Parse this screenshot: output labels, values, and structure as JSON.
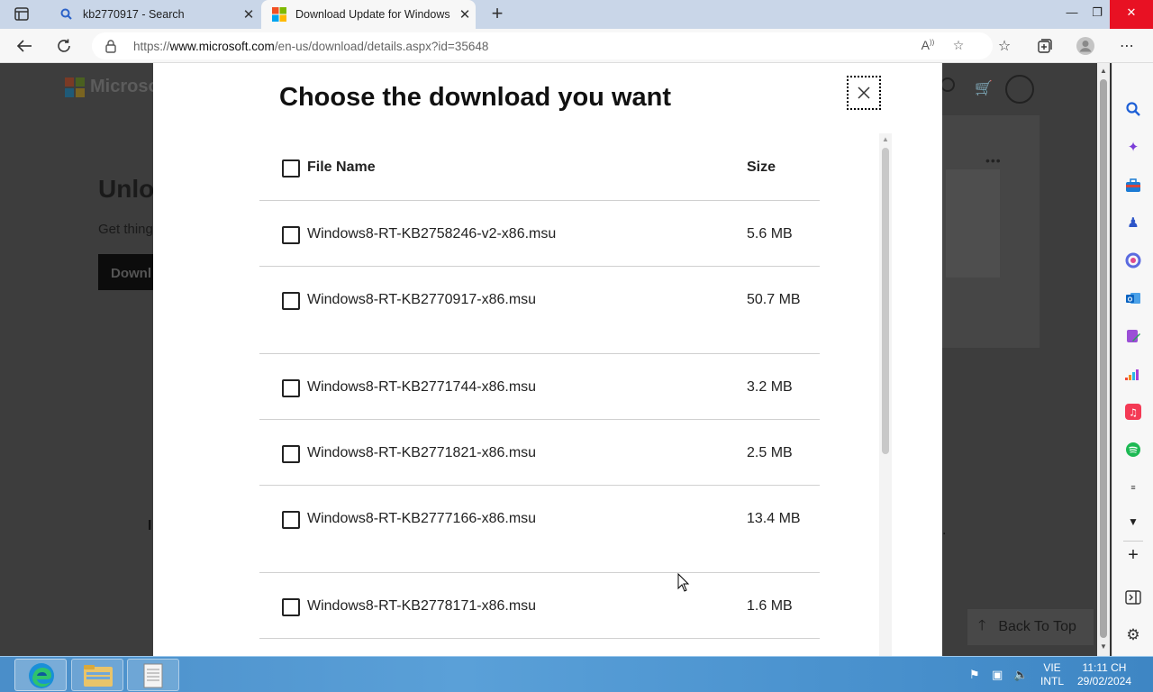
{
  "browser": {
    "tabs": [
      {
        "title": "kb2770917 - Search",
        "active": false
      },
      {
        "title": "Download Update for Windows",
        "active": true
      }
    ],
    "new_tab_label": "+",
    "url_prefix": "https://",
    "url_domain": "www.microsoft.com",
    "url_path": "/en-us/download/details.aspx?id=35648"
  },
  "background_page": {
    "brand": "Microsof",
    "heading": "Unlo",
    "subtext": "Get thing",
    "button": "Downl",
    "stray_text": "I",
    "back_to_top": "Back To Top"
  },
  "modal": {
    "title": "Choose the download you want",
    "header": {
      "name": "File Name",
      "size": "Size"
    },
    "files": [
      {
        "name": "Windows8-RT-KB2758246-v2-x86.msu",
        "size": "5.6 MB"
      },
      {
        "name": "Windows8-RT-KB2770917-x86.msu",
        "size": "50.7 MB"
      },
      {
        "name": "Windows8-RT-KB2771744-x86.msu",
        "size": "3.2 MB"
      },
      {
        "name": "Windows8-RT-KB2771821-x86.msu",
        "size": "2.5 MB"
      },
      {
        "name": "Windows8-RT-KB2777166-x86.msu",
        "size": "13.4 MB"
      },
      {
        "name": "Windows8-RT-KB2778171-x86.msu",
        "size": "1.6 MB"
      }
    ]
  },
  "taskbar": {
    "language_top": "VIE",
    "language_bottom": "INTL",
    "time": "11:11 CH",
    "date": "29/02/2024"
  },
  "colors": {
    "accent": "#0078d4",
    "close_red": "#e81123"
  }
}
